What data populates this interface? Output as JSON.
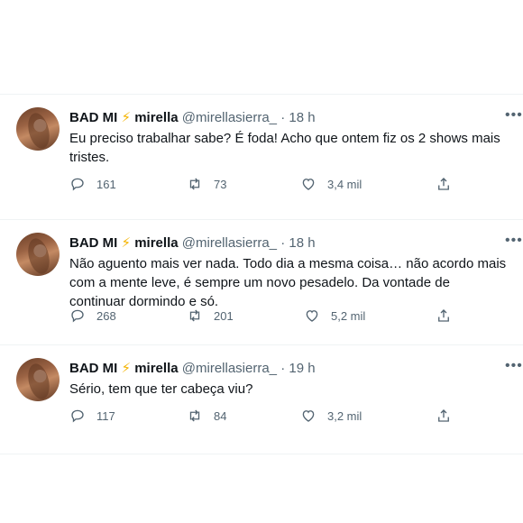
{
  "tweets": [
    {
      "display_name": "BAD MI",
      "emoji": "⚡",
      "username": "mirella",
      "handle": "@mirellasierra_",
      "sep": "·",
      "time": "18 h",
      "text": "Eu preciso trabalhar sabe? É foda! Acho que ontem fiz os 2 shows mais tristes.",
      "replies": "161",
      "retweets": "73",
      "likes": "3,4 mil"
    },
    {
      "display_name": "BAD MI",
      "emoji": "⚡",
      "username": "mirella",
      "handle": "@mirellasierra_",
      "sep": "·",
      "time": "18 h",
      "text": "Não aguento mais ver nada. Todo dia a mesma coisa… não acordo mais com a mente leve, é sempre um novo pesadelo. Da vontade de continuar dormindo e só.",
      "replies": "268",
      "retweets": "201",
      "likes": "5,2 mil"
    },
    {
      "display_name": "BAD MI",
      "emoji": "⚡",
      "username": "mirella",
      "handle": "@mirellasierra_",
      "sep": "·",
      "time": "19 h",
      "text": "Sério, tem que ter cabeça viu?",
      "replies": "117",
      "retweets": "84",
      "likes": "3,2 mil"
    }
  ]
}
